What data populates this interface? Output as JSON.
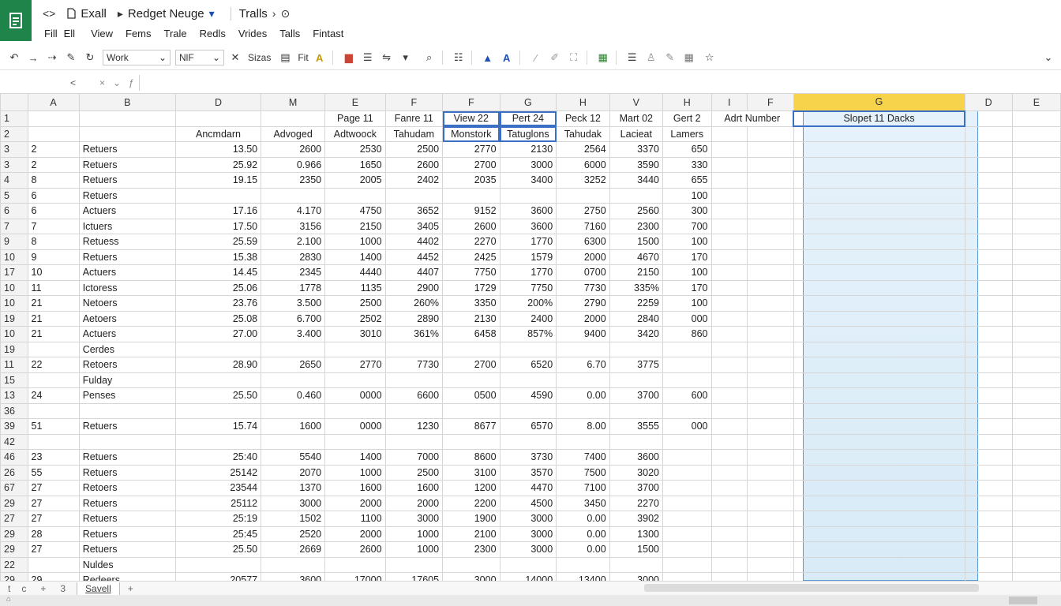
{
  "titlebar": {
    "back_glyph": "<>",
    "doc_name": "Exall",
    "sheet_name": "Redget Neuge",
    "tool_label": "Tralls"
  },
  "menu": [
    "Fill",
    "Ell",
    "View",
    "Fems",
    "Trale",
    "Redls",
    "Vrides",
    "Talls",
    "Fintast"
  ],
  "toolbar": {
    "font_select": "Work",
    "size_select": "NlF",
    "text1": "Sizas",
    "text2": "Fit"
  },
  "namebox": "<",
  "sheet": {
    "columns": [
      "",
      "A",
      "B",
      "D",
      "M",
      "E",
      "F",
      "F",
      "G",
      "H",
      "V",
      "H",
      "I",
      "F",
      "G",
      "D",
      "E"
    ],
    "header_row1": [
      "",
      "",
      "",
      "Page 11",
      "Fanre 11",
      "View 22",
      "Pert 24",
      "Peck 12",
      "Mart 02",
      "Gert 2",
      "Adrt Number",
      "Slopet 11 Dacks"
    ],
    "header_row1_rownum": "1",
    "header_row2": [
      "Ancmdarn",
      "Advoged",
      "Adtwoock",
      "Tahudam",
      "Monstork",
      "Tatuglons",
      "Tahudak",
      "Lacieat",
      "Lamers"
    ],
    "header_row2_rownum": "2",
    "rows": [
      [
        "3",
        "2",
        "Retuers",
        "13.50",
        "2600",
        "2530",
        "2500",
        "2770",
        "2130",
        "2564",
        "3370",
        "650"
      ],
      [
        "3",
        "2",
        "Retuers",
        "25.92",
        "0.966",
        "1650",
        "2600",
        "2700",
        "3000",
        "6000",
        "3590",
        "330"
      ],
      [
        "4",
        "8",
        "Retuers",
        "19.15",
        "2350",
        "2005",
        "2402",
        "2035",
        "3400",
        "3252",
        "3440",
        "655"
      ],
      [
        "5",
        "6",
        "Retuers",
        "",
        "",
        "",
        "",
        "",
        "",
        "",
        "",
        "100"
      ],
      [
        "6",
        "6",
        "Actuers",
        "17.16",
        "4.170",
        "4750",
        "3652",
        "9152",
        "3600",
        "2750",
        "2560",
        "300"
      ],
      [
        "7",
        "7",
        "Ictuers",
        "17.50",
        "3156",
        "2150",
        "3405",
        "2600",
        "3600",
        "7160",
        "2300",
        "700"
      ],
      [
        "9",
        "8",
        "Retuess",
        "25.59",
        "2.100",
        "1000",
        "4402",
        "2270",
        "1770",
        "6300",
        "1500",
        "100"
      ],
      [
        "10",
        "9",
        "Retuers",
        "15.38",
        "2830",
        "1400",
        "4452",
        "2425",
        "1579",
        "2000",
        "4670",
        "170"
      ],
      [
        "17",
        "10",
        "Actuers",
        "14.45",
        "2345",
        "4440",
        "4407",
        "7750",
        "1770",
        "0700",
        "2150",
        "100"
      ],
      [
        "10",
        "11",
        "Ictoress",
        "25.06",
        "1778",
        "1135",
        "2900",
        "1729",
        "7750",
        "7730",
        "335%",
        "170"
      ],
      [
        "10",
        "21",
        "Netoers",
        "23.76",
        "3.500",
        "2500",
        "260%",
        "3350",
        "200%",
        "2790",
        "2259",
        "100"
      ],
      [
        "19",
        "21",
        "Aetoers",
        "25.08",
        "6.700",
        "2502",
        "2890",
        "2130",
        "2400",
        "2000",
        "2840",
        "000"
      ],
      [
        "10",
        "21",
        "Actuers",
        "27.00",
        "3.400",
        "3010",
        "361%",
        "6458",
        "857%",
        "9400",
        "3420",
        "860"
      ],
      [
        "19",
        "",
        "Cerdes",
        "",
        "",
        "",
        "",
        "",
        "",
        "",
        "",
        ""
      ],
      [
        "11",
        "22",
        "Retoers",
        "28.90",
        "2650",
        "2770",
        "7730",
        "2700",
        "6520",
        "6.70",
        "3775",
        ""
      ],
      [
        "15",
        "",
        "Fulday",
        "",
        "",
        "",
        "",
        "",
        "",
        "",
        "",
        ""
      ],
      [
        "13",
        "24",
        "Penses",
        "25.50",
        "0.460",
        "0000",
        "6600",
        "0500",
        "4590",
        "0.00",
        "3700",
        "600"
      ],
      [
        "36",
        "",
        "",
        "",
        "",
        "",
        "",
        "",
        "",
        "",
        "",
        ""
      ],
      [
        "39",
        "51",
        "Retuers",
        "15.74",
        "1600",
        "0000",
        "1230",
        "8677",
        "6570",
        "8.00",
        "3555",
        "000"
      ],
      [
        "42",
        "",
        "",
        "",
        "",
        "",
        "",
        "",
        "",
        "",
        "",
        ""
      ],
      [
        "46",
        "23",
        "Retuers",
        "25:40",
        "5540",
        "1400",
        "7000",
        "8600",
        "3730",
        "7400",
        "3600",
        ""
      ],
      [
        "26",
        "55",
        "Retuers",
        "25142",
        "2070",
        "1000",
        "2500",
        "3100",
        "3570",
        "7500",
        "3020",
        ""
      ],
      [
        "67",
        "27",
        "Retoers",
        "23544",
        "1370",
        "1600",
        "1600",
        "1200",
        "4470",
        "7100",
        "3700",
        ""
      ],
      [
        "29",
        "27",
        "Retuers",
        "25112",
        "3000",
        "2000",
        "2000",
        "2200",
        "4500",
        "3450",
        "2270",
        ""
      ],
      [
        "27",
        "27",
        "Retuers",
        "25:19",
        "1502",
        "1100",
        "3000",
        "1900",
        "3000",
        "0.00",
        "3902",
        ""
      ],
      [
        "29",
        "28",
        "Retuers",
        "25:45",
        "2520",
        "2000",
        "1000",
        "2100",
        "3000",
        "0.00",
        "1300",
        ""
      ],
      [
        "29",
        "27",
        "Retuers",
        "25.50",
        "2669",
        "2600",
        "1000",
        "2300",
        "3000",
        "0.00",
        "1500",
        ""
      ],
      [
        "22",
        "",
        "Nuldes",
        "",
        "",
        "",
        "",
        "",
        "",
        "",
        "",
        ""
      ],
      [
        "29",
        "29",
        "Redeers",
        "20577",
        "3600",
        "17000",
        "17605",
        "3000",
        "14000",
        "13400",
        "3000",
        ""
      ]
    ]
  },
  "tabs": {
    "nav1": "t",
    "nav2": "c",
    "add": "+",
    "sheet_num": "3",
    "active": "Savell",
    "more": "+"
  },
  "colors": {
    "logo_bg": "#1e8449",
    "highlight_header": "#f6d34a",
    "highlight_column": "#dcedf8",
    "selection_border": "#3a6fc4"
  }
}
